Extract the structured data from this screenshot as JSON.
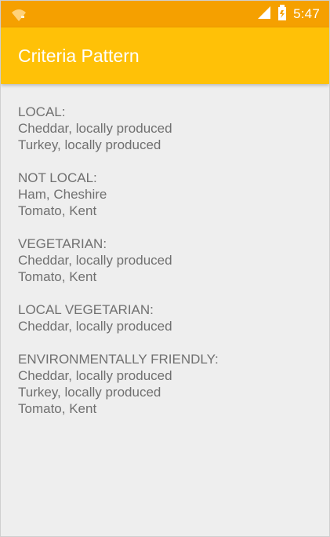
{
  "status_bar": {
    "time": "5:47",
    "icons": [
      "wifi-icon",
      "signal-icon",
      "battery-icon"
    ]
  },
  "app_bar": {
    "title": "Criteria Pattern"
  },
  "groups": [
    {
      "header": "LOCAL:",
      "items": [
        "Cheddar, locally produced",
        "Turkey, locally produced"
      ]
    },
    {
      "header": "NOT LOCAL:",
      "items": [
        "Ham, Cheshire",
        "Tomato, Kent"
      ]
    },
    {
      "header": "VEGETARIAN:",
      "items": [
        "Cheddar, locally produced",
        "Tomato, Kent"
      ]
    },
    {
      "header": "LOCAL VEGETARIAN:",
      "items": [
        "Cheddar, locally produced"
      ]
    },
    {
      "header": "ENVIRONMENTALLY FRIENDLY:",
      "items": [
        "Cheddar, locally produced",
        "Turkey, locally produced",
        "Tomato, Kent"
      ]
    }
  ],
  "colors": {
    "status_bar": "#f5a000",
    "app_bar": "#ffc107",
    "background": "#eeeeee",
    "text": "#707070"
  }
}
